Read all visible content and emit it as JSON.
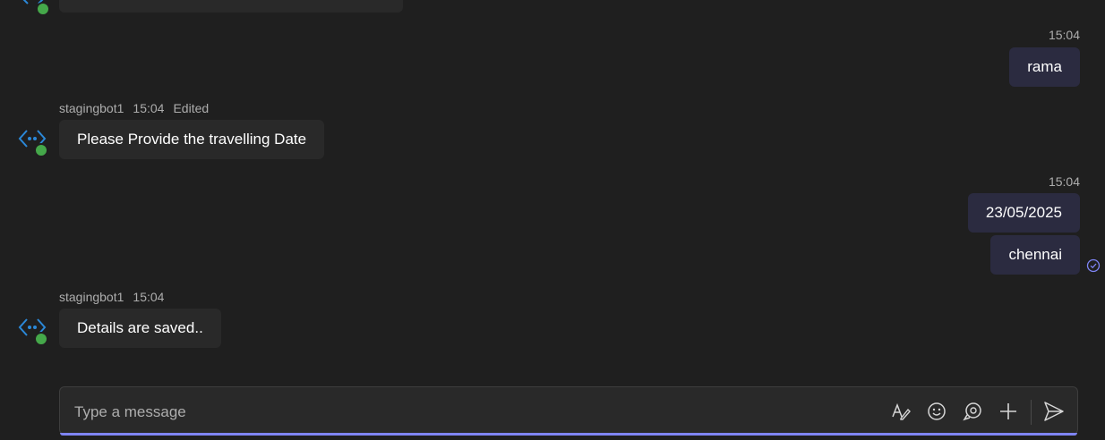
{
  "messages": {
    "rama": {
      "time": "15:04",
      "text": "rama"
    },
    "bot1": {
      "sender": "stagingbot1",
      "time": "15:04",
      "edited": "Edited",
      "text": "Please Provide the travelling Date"
    },
    "user_date": {
      "time": "15:04",
      "text": "23/05/2025"
    },
    "user_city": {
      "text": "chennai"
    },
    "bot2": {
      "sender": "stagingbot1",
      "time": "15:04",
      "text": "Details are saved.."
    }
  },
  "composer": {
    "placeholder": "Type a message",
    "tools": [
      "format-icon",
      "emoji-icon",
      "loop-icon",
      "plus-icon",
      "send-icon"
    ]
  },
  "colors": {
    "background": "#1f1f1f",
    "incoming_bubble": "#292929",
    "outgoing_bubble": "#2b2b40",
    "accent": "#7f85f5",
    "bot_icon": "#2b88d8",
    "status_green": "#45a84a"
  }
}
